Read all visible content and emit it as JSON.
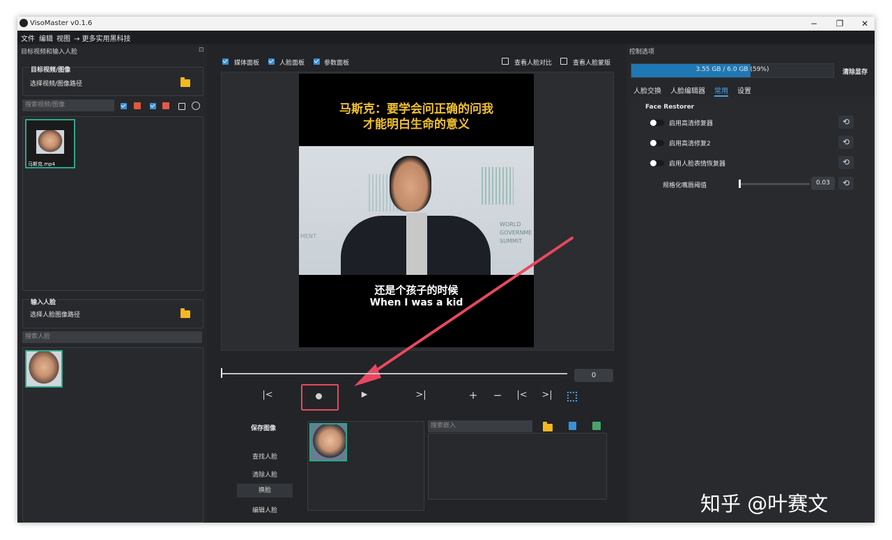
{
  "window": {
    "title": "VisoMaster v0.1.6"
  },
  "menu": [
    "文件",
    "编辑",
    "视图",
    "→ 更多实用黑科技"
  ],
  "left_panel": {
    "header": "目标视频和输入人脸",
    "target_group": {
      "title": "目标视频/图像",
      "path_label": "选择视频/图像路径"
    },
    "search_target_placeholder": "搜索视频/图像",
    "target_thumb_caption": "马斯克.mp4",
    "input_group": {
      "title": "输入人脸",
      "path_label": "选择人脸图像路径"
    },
    "search_face_placeholder": "搜索人脸"
  },
  "center": {
    "checks": [
      {
        "label": "媒体面板",
        "checked": true
      },
      {
        "label": "人脸面板",
        "checked": true
      },
      {
        "label": "参数面板",
        "checked": true
      }
    ],
    "right_checks": [
      {
        "label": "查看人脸对比",
        "checked": false
      },
      {
        "label": "查看人脸蒙版",
        "checked": false
      }
    ],
    "video": {
      "caption_top_1": "马斯克：要学会问正确的问我",
      "caption_top_2": "才能明白生命的意义",
      "subtitle_cn": "还是个孩子的时候",
      "subtitle_en": "When I was a kid",
      "sign_left": "MENT",
      "sign_right_1": "WORLD",
      "sign_right_2": "GOVERNME",
      "sign_right_3": "SUMMIT"
    },
    "frame_number": "0",
    "save_image_label": "保存图像",
    "search_embed_placeholder": "搜索嵌入",
    "face_buttons": [
      "查找人脸",
      "清除人脸",
      "换脸",
      "编辑人脸"
    ],
    "selected_face_button": "换脸"
  },
  "right_panel": {
    "header": "控制选项",
    "memory": {
      "text": "3.55 GB / 6.0 GB (59%)",
      "fraction": 0.59
    },
    "clear_memory_label": "清除显存",
    "tabs": [
      "人脸交换",
      "人脸编辑器",
      "常用",
      "设置"
    ],
    "active_tab": "常用",
    "section_title": "Face Restorer",
    "toggles": [
      {
        "label": "启用高清修复器",
        "on": false
      },
      {
        "label": "启用高清修复2",
        "on": false
      },
      {
        "label": "启用人脸表情恢复器",
        "on": false
      }
    ],
    "slider": {
      "label": "规格化嘴唇阈值",
      "value": "0.03"
    }
  },
  "watermark": "知乎 @叶赛文",
  "colors": {
    "accent": "#3d8fd1",
    "highlight": "#e8485f",
    "thumb_border": "#2fa58a",
    "memory_bar": "#1f78b4"
  },
  "icons": [
    "app-icon",
    "folder-icon",
    "save-icon",
    "record-icon",
    "play-icon",
    "skip-start-icon",
    "skip-end-icon",
    "plus-icon",
    "minus-icon",
    "prev-frame-icon",
    "next-frame-icon",
    "fullscreen-icon",
    "reset-icon"
  ]
}
